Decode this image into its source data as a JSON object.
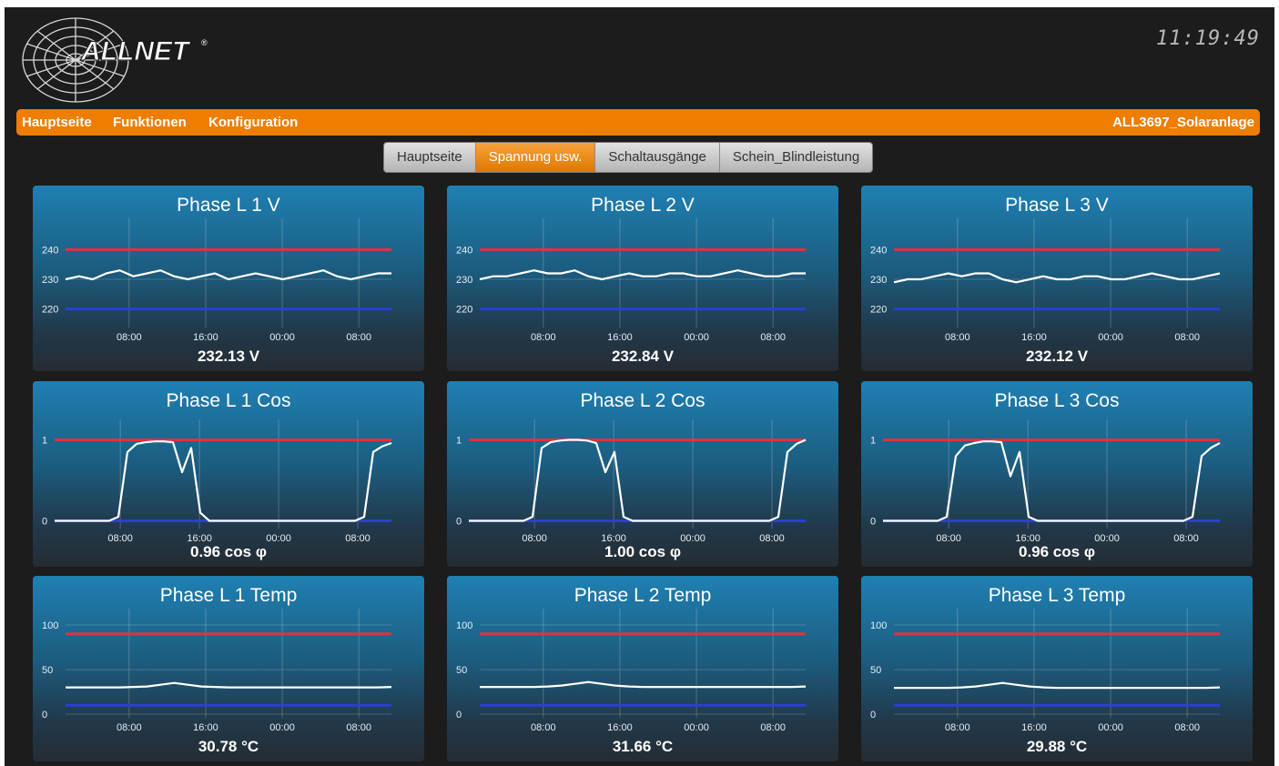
{
  "header": {
    "clock": "11:19:49"
  },
  "logo": {
    "text": "ALLNET"
  },
  "nav": {
    "links": [
      "Hauptseite",
      "Funktionen",
      "Konfiguration"
    ],
    "device_name": "ALL3697_Solaranlage"
  },
  "tabs": [
    {
      "label": "Hauptseite",
      "active": false
    },
    {
      "label": "Spannung usw.",
      "active": true
    },
    {
      "label": "Schaltausgänge",
      "active": false
    },
    {
      "label": "Schein_Blindleistung",
      "active": false
    }
  ],
  "colors": {
    "accent": "#ef7d00",
    "upper_limit": "#e0333a",
    "lower_limit": "#2b3fd6",
    "line": "#ffffff"
  },
  "time_ticks": [
    "08:00",
    "16:00",
    "00:00",
    "08:00"
  ],
  "panels": [
    {
      "title": "Phase L 1 V",
      "value": "232.13 V"
    },
    {
      "title": "Phase L 2 V",
      "value": "232.84 V"
    },
    {
      "title": "Phase L 3 V",
      "value": "232.12 V"
    },
    {
      "title": "Phase L 1 Cos",
      "value": "0.96 cos φ"
    },
    {
      "title": "Phase L 2 Cos",
      "value": "1.00 cos φ"
    },
    {
      "title": "Phase L 3 Cos",
      "value": "0.96 cos φ"
    },
    {
      "title": "Phase L 1 Temp",
      "value": "30.78 °C"
    },
    {
      "title": "Phase L 2 Temp",
      "value": "31.66 °C"
    },
    {
      "title": "Phase L 3 Temp",
      "value": "29.88 °C"
    }
  ],
  "chart_data": [
    {
      "type": "line",
      "series": [
        {
          "values": [
            230,
            231,
            230,
            232,
            233,
            231,
            232,
            233,
            231,
            230,
            231,
            232,
            230,
            231,
            232,
            231,
            230,
            231,
            232,
            233,
            231,
            230,
            231,
            232,
            232
          ]
        }
      ],
      "y_ticks": [
        240,
        230,
        220
      ],
      "upper_limit": 240,
      "lower_limit": 220,
      "ylim": [
        215,
        245
      ]
    },
    {
      "type": "line",
      "series": [
        {
          "values": [
            230,
            231,
            231,
            232,
            233,
            232,
            232,
            233,
            231,
            230,
            231,
            232,
            231,
            231,
            232,
            232,
            231,
            231,
            232,
            233,
            232,
            231,
            231,
            232,
            232
          ]
        }
      ],
      "y_ticks": [
        240,
        230,
        220
      ],
      "upper_limit": 240,
      "lower_limit": 220,
      "ylim": [
        215,
        245
      ]
    },
    {
      "type": "line",
      "series": [
        {
          "values": [
            229,
            230,
            230,
            231,
            232,
            231,
            232,
            232,
            230,
            229,
            230,
            231,
            230,
            230,
            231,
            231,
            230,
            230,
            231,
            232,
            231,
            230,
            230,
            231,
            232
          ]
        }
      ],
      "y_ticks": [
        240,
        230,
        220
      ],
      "upper_limit": 240,
      "lower_limit": 220,
      "ylim": [
        215,
        245
      ]
    },
    {
      "type": "line",
      "series": [
        {
          "values": [
            0,
            0,
            0,
            0,
            0,
            0,
            0,
            0.05,
            0.85,
            0.95,
            0.97,
            0.98,
            0.98,
            0.97,
            0.6,
            0.9,
            0.1,
            0,
            0,
            0,
            0,
            0,
            0,
            0,
            0,
            0,
            0,
            0,
            0,
            0,
            0,
            0,
            0,
            0,
            0.05,
            0.85,
            0.92,
            0.96
          ]
        }
      ],
      "y_ticks": [
        1,
        0
      ],
      "upper_limit": 1,
      "lower_limit": 0,
      "ylim": [
        -0.05,
        1.05
      ]
    },
    {
      "type": "line",
      "series": [
        {
          "values": [
            0,
            0,
            0,
            0,
            0,
            0,
            0,
            0.05,
            0.9,
            0.97,
            0.99,
            1.0,
            1.0,
            0.99,
            0.96,
            0.6,
            0.85,
            0.05,
            0,
            0,
            0,
            0,
            0,
            0,
            0,
            0,
            0,
            0,
            0,
            0,
            0,
            0,
            0,
            0,
            0.05,
            0.85,
            0.95,
            1.0
          ]
        }
      ],
      "y_ticks": [
        1,
        0
      ],
      "upper_limit": 1,
      "lower_limit": 0,
      "ylim": [
        -0.05,
        1.05
      ]
    },
    {
      "type": "line",
      "series": [
        {
          "values": [
            0,
            0,
            0,
            0,
            0,
            0,
            0,
            0.05,
            0.8,
            0.93,
            0.96,
            0.98,
            0.98,
            0.97,
            0.55,
            0.85,
            0.05,
            0,
            0,
            0,
            0,
            0,
            0,
            0,
            0,
            0,
            0,
            0,
            0,
            0,
            0,
            0,
            0,
            0,
            0.05,
            0.8,
            0.9,
            0.96
          ]
        }
      ],
      "y_ticks": [
        1,
        0
      ],
      "upper_limit": 1,
      "lower_limit": 0,
      "ylim": [
        -0.05,
        1.05
      ]
    },
    {
      "type": "line",
      "series": [
        {
          "values": [
            30,
            30,
            30,
            30,
            30,
            30.5,
            31,
            33,
            35,
            33,
            31,
            30.5,
            30,
            30,
            30,
            30,
            30,
            30,
            30,
            30,
            30,
            30,
            30,
            30,
            30.5
          ]
        }
      ],
      "y_ticks": [
        100,
        50,
        0
      ],
      "upper_limit": 90,
      "lower_limit": 10,
      "ylim": [
        0,
        100
      ]
    },
    {
      "type": "line",
      "series": [
        {
          "values": [
            30.5,
            30.5,
            30.5,
            30.5,
            30.5,
            31,
            32,
            34,
            36,
            34,
            32,
            31,
            30.5,
            30.5,
            30.5,
            30.5,
            30.5,
            30.5,
            30.5,
            30.5,
            30.5,
            30.5,
            30.5,
            30.5,
            31
          ]
        }
      ],
      "y_ticks": [
        100,
        50,
        0
      ],
      "upper_limit": 90,
      "lower_limit": 10,
      "ylim": [
        0,
        100
      ]
    },
    {
      "type": "line",
      "series": [
        {
          "values": [
            29.5,
            29.5,
            29.5,
            29.5,
            29.5,
            30,
            31,
            33,
            35,
            33,
            31,
            30,
            29.5,
            29.5,
            29.5,
            29.5,
            29.5,
            29.5,
            29.5,
            29.5,
            29.5,
            29.5,
            29.5,
            29.5,
            30
          ]
        }
      ],
      "y_ticks": [
        100,
        50,
        0
      ],
      "upper_limit": 90,
      "lower_limit": 10,
      "ylim": [
        0,
        100
      ]
    }
  ]
}
